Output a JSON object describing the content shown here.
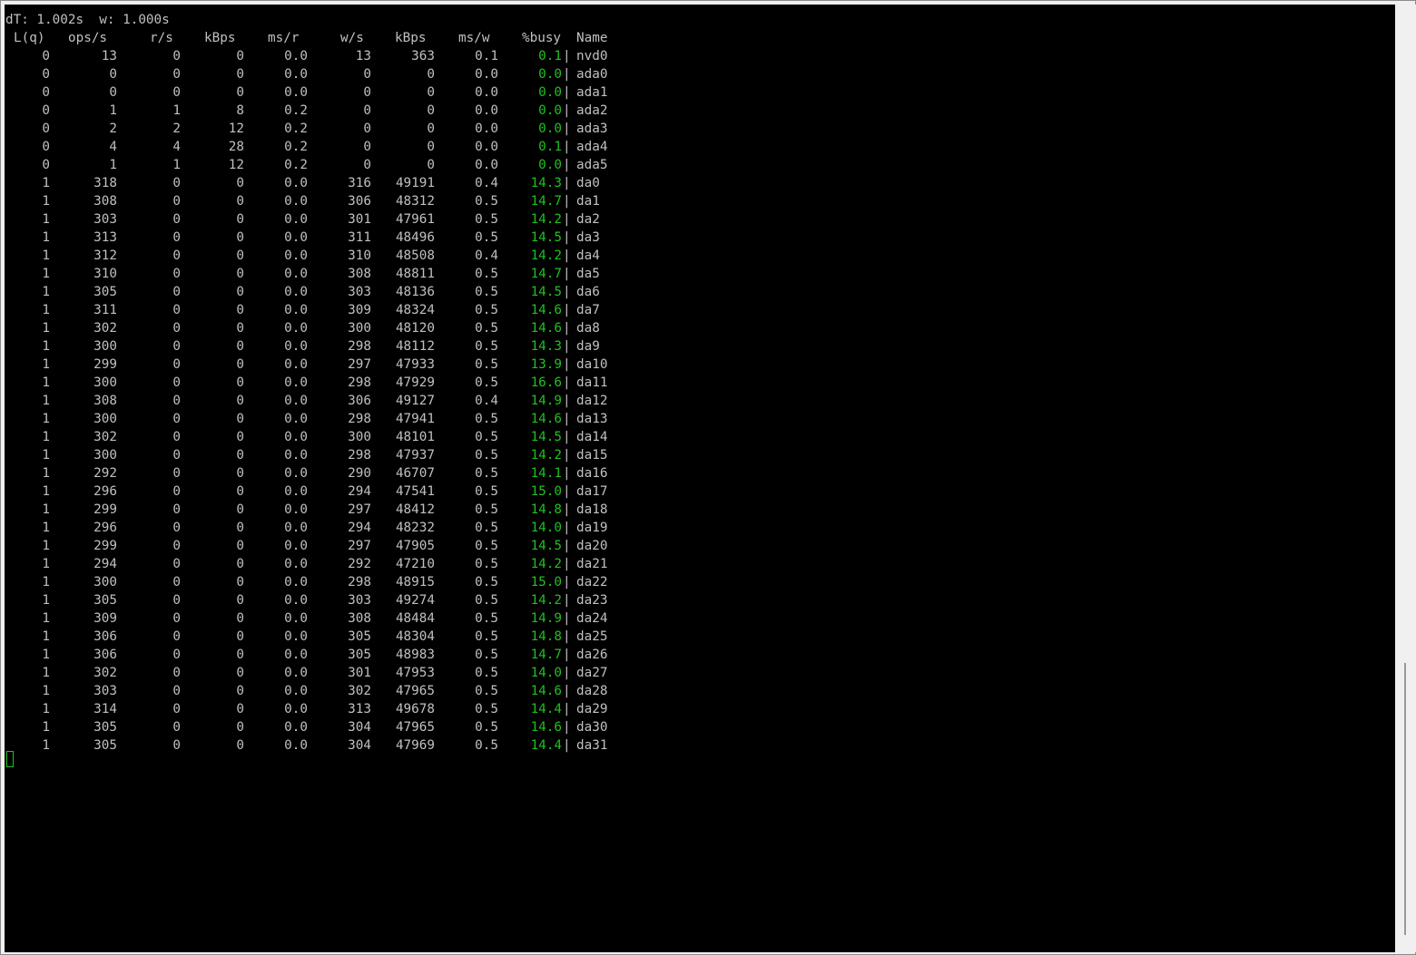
{
  "terminal": {
    "status_line": "dT: 1.002s  w: 1.000s",
    "headers": {
      "lq": "L(q)",
      "ops": "ops/s",
      "rs": "r/s",
      "kbps_r": "kBps",
      "msr": "ms/r",
      "ws": "w/s",
      "kbps_w": "kBps",
      "msw": "ms/w",
      "busy": "%busy",
      "name": "Name"
    },
    "separator": "|",
    "rows": [
      [
        "0",
        "13",
        "0",
        "0",
        "0.0",
        "13",
        "363",
        "0.1",
        "0.1",
        "nvd0"
      ],
      [
        "0",
        "0",
        "0",
        "0",
        "0.0",
        "0",
        "0",
        "0.0",
        "0.0",
        "ada0"
      ],
      [
        "0",
        "0",
        "0",
        "0",
        "0.0",
        "0",
        "0",
        "0.0",
        "0.0",
        "ada1"
      ],
      [
        "0",
        "1",
        "1",
        "8",
        "0.2",
        "0",
        "0",
        "0.0",
        "0.0",
        "ada2"
      ],
      [
        "0",
        "2",
        "2",
        "12",
        "0.2",
        "0",
        "0",
        "0.0",
        "0.0",
        "ada3"
      ],
      [
        "0",
        "4",
        "4",
        "28",
        "0.2",
        "0",
        "0",
        "0.0",
        "0.1",
        "ada4"
      ],
      [
        "0",
        "1",
        "1",
        "12",
        "0.2",
        "0",
        "0",
        "0.0",
        "0.0",
        "ada5"
      ],
      [
        "1",
        "318",
        "0",
        "0",
        "0.0",
        "316",
        "49191",
        "0.4",
        "14.3",
        "da0"
      ],
      [
        "1",
        "308",
        "0",
        "0",
        "0.0",
        "306",
        "48312",
        "0.5",
        "14.7",
        "da1"
      ],
      [
        "1",
        "303",
        "0",
        "0",
        "0.0",
        "301",
        "47961",
        "0.5",
        "14.2",
        "da2"
      ],
      [
        "1",
        "313",
        "0",
        "0",
        "0.0",
        "311",
        "48496",
        "0.5",
        "14.5",
        "da3"
      ],
      [
        "1",
        "312",
        "0",
        "0",
        "0.0",
        "310",
        "48508",
        "0.4",
        "14.2",
        "da4"
      ],
      [
        "1",
        "310",
        "0",
        "0",
        "0.0",
        "308",
        "48811",
        "0.5",
        "14.7",
        "da5"
      ],
      [
        "1",
        "305",
        "0",
        "0",
        "0.0",
        "303",
        "48136",
        "0.5",
        "14.5",
        "da6"
      ],
      [
        "1",
        "311",
        "0",
        "0",
        "0.0",
        "309",
        "48324",
        "0.5",
        "14.6",
        "da7"
      ],
      [
        "1",
        "302",
        "0",
        "0",
        "0.0",
        "300",
        "48120",
        "0.5",
        "14.6",
        "da8"
      ],
      [
        "1",
        "300",
        "0",
        "0",
        "0.0",
        "298",
        "48112",
        "0.5",
        "14.3",
        "da9"
      ],
      [
        "1",
        "299",
        "0",
        "0",
        "0.0",
        "297",
        "47933",
        "0.5",
        "13.9",
        "da10"
      ],
      [
        "1",
        "300",
        "0",
        "0",
        "0.0",
        "298",
        "47929",
        "0.5",
        "16.6",
        "da11"
      ],
      [
        "1",
        "308",
        "0",
        "0",
        "0.0",
        "306",
        "49127",
        "0.4",
        "14.9",
        "da12"
      ],
      [
        "1",
        "300",
        "0",
        "0",
        "0.0",
        "298",
        "47941",
        "0.5",
        "14.6",
        "da13"
      ],
      [
        "1",
        "302",
        "0",
        "0",
        "0.0",
        "300",
        "48101",
        "0.5",
        "14.5",
        "da14"
      ],
      [
        "1",
        "300",
        "0",
        "0",
        "0.0",
        "298",
        "47937",
        "0.5",
        "14.2",
        "da15"
      ],
      [
        "1",
        "292",
        "0",
        "0",
        "0.0",
        "290",
        "46707",
        "0.5",
        "14.1",
        "da16"
      ],
      [
        "1",
        "296",
        "0",
        "0",
        "0.0",
        "294",
        "47541",
        "0.5",
        "15.0",
        "da17"
      ],
      [
        "1",
        "299",
        "0",
        "0",
        "0.0",
        "297",
        "48412",
        "0.5",
        "14.8",
        "da18"
      ],
      [
        "1",
        "296",
        "0",
        "0",
        "0.0",
        "294",
        "48232",
        "0.5",
        "14.0",
        "da19"
      ],
      [
        "1",
        "299",
        "0",
        "0",
        "0.0",
        "297",
        "47905",
        "0.5",
        "14.5",
        "da20"
      ],
      [
        "1",
        "294",
        "0",
        "0",
        "0.0",
        "292",
        "47210",
        "0.5",
        "14.2",
        "da21"
      ],
      [
        "1",
        "300",
        "0",
        "0",
        "0.0",
        "298",
        "48915",
        "0.5",
        "15.0",
        "da22"
      ],
      [
        "1",
        "305",
        "0",
        "0",
        "0.0",
        "303",
        "49274",
        "0.5",
        "14.2",
        "da23"
      ],
      [
        "1",
        "309",
        "0",
        "0",
        "0.0",
        "308",
        "48484",
        "0.5",
        "14.9",
        "da24"
      ],
      [
        "1",
        "306",
        "0",
        "0",
        "0.0",
        "305",
        "48304",
        "0.5",
        "14.8",
        "da25"
      ],
      [
        "1",
        "306",
        "0",
        "0",
        "0.0",
        "305",
        "48983",
        "0.5",
        "14.7",
        "da26"
      ],
      [
        "1",
        "302",
        "0",
        "0",
        "0.0",
        "301",
        "47953",
        "0.5",
        "14.0",
        "da27"
      ],
      [
        "1",
        "303",
        "0",
        "0",
        "0.0",
        "302",
        "47965",
        "0.5",
        "14.6",
        "da28"
      ],
      [
        "1",
        "314",
        "0",
        "0",
        "0.0",
        "313",
        "49678",
        "0.5",
        "14.4",
        "da29"
      ],
      [
        "1",
        "305",
        "0",
        "0",
        "0.0",
        "304",
        "47965",
        "0.5",
        "14.6",
        "da30"
      ],
      [
        "1",
        "305",
        "0",
        "0",
        "0.0",
        "304",
        "47969",
        "0.5",
        "14.4",
        "da31"
      ]
    ]
  },
  "colors": {
    "background": "#000000",
    "text": "#c0c0c0",
    "busy": "#1fc21f"
  }
}
